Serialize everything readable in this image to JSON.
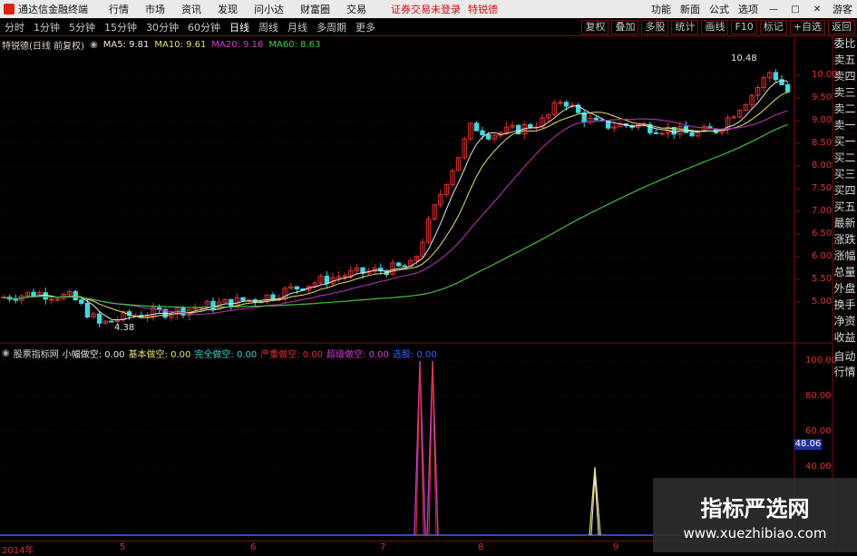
{
  "titlebar": {
    "app_name": "通达信金融终端",
    "menus": [
      "行情",
      "市场",
      "资讯",
      "发现",
      "问小达",
      "财富圈",
      "交易"
    ],
    "notice": "证券交易未登录",
    "stock_name": "特锐德",
    "right_items": [
      "功能",
      "新面",
      "公式",
      "选项"
    ],
    "guest": "游客"
  },
  "toolbar": {
    "periods": [
      "分时",
      "1分钟",
      "5分钟",
      "15分钟",
      "30分钟",
      "60分钟",
      "日线",
      "周线",
      "月线",
      "多周期",
      "更多"
    ],
    "active_period": "日线",
    "right_tabs": [
      "复权",
      "叠加",
      "多股",
      "统计",
      "画线",
      "F10",
      "标记",
      "+自选",
      "返回"
    ]
  },
  "ma_legend": {
    "title": "特锐德(日线 前复权)",
    "items": [
      {
        "label": "MA5: 9.81",
        "color": "#e8e8e8"
      },
      {
        "label": "MA10: 9.61",
        "color": "#e8e070"
      },
      {
        "label": "MA20: 9.16",
        "color": "#d040d0"
      },
      {
        "label": "MA60: 8.63",
        "color": "#40d040"
      }
    ]
  },
  "price_axis": [
    "10.00",
    "9.50",
    "9.00",
    "8.50",
    "8.00",
    "7.50",
    "7.00",
    "6.50",
    "6.00",
    "5.50",
    "5.00"
  ],
  "annotations": {
    "high": "10.48",
    "low": "4.38"
  },
  "indicator_legend": {
    "title": "股票指标网",
    "items": [
      {
        "label": "小幅做空: 0.00",
        "color": "#e8e8e8"
      },
      {
        "label": "基本做空: 0.00",
        "color": "#e8e070"
      },
      {
        "label": "完全做空: 0.00",
        "color": "#40d0d0"
      },
      {
        "label": "严重做空: 0.00",
        "color": "#e03030"
      },
      {
        "label": "超级做空: 0.00",
        "color": "#d040d0"
      },
      {
        "label": "选股: 0.00",
        "color": "#4060ff"
      }
    ]
  },
  "indicator_axis": [
    "100.00",
    "80.00",
    "60.00",
    "40.00"
  ],
  "indicator_current": "48.06",
  "right_panel": [
    "委比",
    "卖五",
    "卖四",
    "卖三",
    "卖二",
    "卖一",
    "买一",
    "买二",
    "买三",
    "买四",
    "买五",
    "最新",
    "涨跌",
    "涨幅",
    "总量",
    "外盘",
    "换手",
    "净资",
    "收益"
  ],
  "auto_panel": [
    "自动",
    "行情"
  ],
  "date_axis": [
    "2014年",
    "5",
    "6",
    "7",
    "8",
    "9"
  ],
  "watermark": {
    "line1": "指标严选网",
    "line2": "www.xuezhibiao.com"
  },
  "colors": {
    "up": "#e03030",
    "down": "#40d8e0",
    "ma5": "#e8e8e8",
    "ma10": "#e8e070",
    "ma20": "#a030a0",
    "ma60": "#40c040"
  }
}
